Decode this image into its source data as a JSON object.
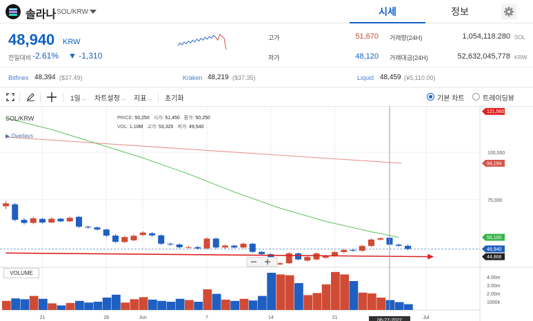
{
  "header": {
    "coin_name": "솔라나",
    "pair": "SOL/KRW",
    "tabs": [
      {
        "label": "시세",
        "active": true
      },
      {
        "label": "정보",
        "active": false
      }
    ]
  },
  "ticker": {
    "price": "48,940",
    "unit": "KRW",
    "change_label": "전일대비",
    "change_pct": "-2.61%",
    "change_abs": "▼ -1,310",
    "high_label": "고가",
    "high_value": "51,670",
    "low_label": "저가",
    "low_value": "48,120",
    "volume_label": "거래량(24H)",
    "volume_value": "1,054,118.280",
    "volume_unit": "SOL",
    "amount_label": "거래대금(24H)",
    "amount_value": "52,632,045,778",
    "amount_unit": "KRW",
    "sparkline": [
      30,
      33,
      31,
      34,
      32,
      35,
      33,
      36,
      34,
      37,
      35,
      38,
      36,
      39,
      37,
      40,
      38,
      41,
      39,
      36,
      42,
      40,
      38,
      26
    ]
  },
  "exchanges": [
    {
      "name": "Bitfinex",
      "price": "48,394",
      "sub": "($37.49)"
    },
    {
      "name": "Kraken",
      "price": "48,219",
      "sub": "($37.35)"
    },
    {
      "name": "Liquid",
      "price": "48,459",
      "sub": "(¥5,110.00)"
    }
  ],
  "toolbar": {
    "interval": "1일",
    "chart_settings": "차트설정",
    "indicators": "지표",
    "reset": "초기화",
    "basic_chart": "기본 차트",
    "tradingview": "트레이딩뷰"
  },
  "chart_labels": {
    "symbol": "SOL/KRW",
    "overlays": "Overlays",
    "volume_box": "VOLUME",
    "ohlc": {
      "price_label": "PRICE:",
      "price": "50,250",
      "open_label": "시가:",
      "open": "51,450",
      "close_label": "종가:",
      "close": "50,250",
      "vol_label": "VOL:",
      "vol": "1.10M",
      "high_label": "고가:",
      "high": "53,320",
      "low_label": "저가:",
      "low": "49,540"
    }
  },
  "chart_data": {
    "type": "candlestick",
    "y_ticks": [
      "100,000",
      "75,000"
    ],
    "y_tick_values": [
      100000,
      75000
    ],
    "vol_ticks": [
      "4.00m",
      "3.00m",
      "2.00m",
      "1000k"
    ],
    "vol_tick_values": [
      4000000,
      3000000,
      2000000,
      1000000
    ],
    "x_ticks": [
      "21",
      "28",
      "Jun",
      "7",
      "14",
      "21",
      "Jul"
    ],
    "x_tick_index": [
      4,
      11,
      15,
      22,
      29,
      36,
      46
    ],
    "ylim": [
      40000,
      124000
    ],
    "vol_max": 5000000,
    "crosshair_index": 42,
    "crosshair_date": "06-27-2022",
    "price_tags": [
      {
        "value": 121560,
        "label": "121,560",
        "color": "#e02020"
      },
      {
        "value": 94194,
        "label": "94,194",
        "color": "#d5574a"
      },
      {
        "value": 55100,
        "label": "55,100",
        "color": "#36b34a"
      },
      {
        "value": 48940,
        "label": "48,940",
        "color": "#1f5fbf"
      },
      {
        "value": 44868,
        "label": "44,868",
        "color": "#222222"
      }
    ],
    "ma_long": {
      "color": "#e58b86",
      "from": [
        0,
        108000
      ],
      "to": [
        43,
        94194
      ]
    },
    "ma_short": {
      "color": "#5dc25d",
      "points": [
        [
          0,
          118000
        ],
        [
          5,
          112000
        ],
        [
          10,
          104500
        ],
        [
          15,
          97000
        ],
        [
          20,
          88500
        ],
        [
          25,
          79000
        ],
        [
          30,
          70500
        ],
        [
          35,
          63500
        ],
        [
          40,
          58000
        ],
        [
          43,
          55100
        ]
      ]
    },
    "trend_line": {
      "color": "#dd2020",
      "from": [
        0,
        46800
      ],
      "to": [
        47,
        44868
      ]
    },
    "current_price": 48940,
    "candles": [
      {
        "o": 71500,
        "c": 73000,
        "h": 74200,
        "l": 70000,
        "v": 1100000
      },
      {
        "o": 72500,
        "c": 64300,
        "h": 73200,
        "l": 63500,
        "v": 1400000
      },
      {
        "o": 64300,
        "c": 62700,
        "h": 65200,
        "l": 61800,
        "v": 1300000
      },
      {
        "o": 62700,
        "c": 65100,
        "h": 66000,
        "l": 62000,
        "v": 1700000
      },
      {
        "o": 64800,
        "c": 62900,
        "h": 65400,
        "l": 62300,
        "v": 1350000
      },
      {
        "o": 62900,
        "c": 64900,
        "h": 65700,
        "l": 62600,
        "v": 800000
      },
      {
        "o": 64900,
        "c": 63500,
        "h": 65300,
        "l": 63100,
        "v": 550000
      },
      {
        "o": 63500,
        "c": 65400,
        "h": 66100,
        "l": 63200,
        "v": 850000
      },
      {
        "o": 65900,
        "c": 60700,
        "h": 66400,
        "l": 60000,
        "v": 1100000
      },
      {
        "o": 60700,
        "c": 60300,
        "h": 61200,
        "l": 59500,
        "v": 900000
      },
      {
        "o": 60300,
        "c": 59200,
        "h": 60900,
        "l": 58700,
        "v": 1000000
      },
      {
        "o": 59200,
        "c": 56000,
        "h": 59600,
        "l": 55300,
        "v": 1500000
      },
      {
        "o": 56000,
        "c": 52700,
        "h": 56800,
        "l": 52100,
        "v": 1850000
      },
      {
        "o": 52600,
        "c": 55200,
        "h": 55900,
        "l": 52000,
        "v": 900000
      },
      {
        "o": 53500,
        "c": 55900,
        "h": 56600,
        "l": 53000,
        "v": 1300000
      },
      {
        "o": 56300,
        "c": 57600,
        "h": 58300,
        "l": 55700,
        "v": 1550000
      },
      {
        "o": 57200,
        "c": 56100,
        "h": 57900,
        "l": 55400,
        "v": 1250000
      },
      {
        "o": 56100,
        "c": 51700,
        "h": 56700,
        "l": 51000,
        "v": 1100000
      },
      {
        "o": 51700,
        "c": 51300,
        "h": 52200,
        "l": 50600,
        "v": 1000000
      },
      {
        "o": 51300,
        "c": 49800,
        "h": 51900,
        "l": 49100,
        "v": 1350000
      },
      {
        "o": 49800,
        "c": 49900,
        "h": 50600,
        "l": 49200,
        "v": 1200000
      },
      {
        "o": 49900,
        "c": 49200,
        "h": 50600,
        "l": 48600,
        "v": 1000000
      },
      {
        "o": 49200,
        "c": 54400,
        "h": 55100,
        "l": 48800,
        "v": 2500000
      },
      {
        "o": 54400,
        "c": 49700,
        "h": 55100,
        "l": 49100,
        "v": 1950000
      },
      {
        "o": 49700,
        "c": 50700,
        "h": 51400,
        "l": 49100,
        "v": 1250000
      },
      {
        "o": 50700,
        "c": 49700,
        "h": 51200,
        "l": 49200,
        "v": 1100000
      },
      {
        "o": 49700,
        "c": 51700,
        "h": 52300,
        "l": 49200,
        "v": 1350000
      },
      {
        "o": 51700,
        "c": 47400,
        "h": 52200,
        "l": 46900,
        "v": 1150000
      },
      {
        "o": 47400,
        "c": 46200,
        "h": 47900,
        "l": 45600,
        "v": 1700000
      },
      {
        "o": 46200,
        "c": 40800,
        "h": 46600,
        "l": 40100,
        "v": 4500000
      },
      {
        "o": 40800,
        "c": 41400,
        "h": 42100,
        "l": 40200,
        "v": 4300000
      },
      {
        "o": 41400,
        "c": 46600,
        "h": 47200,
        "l": 40900,
        "v": 4200000
      },
      {
        "o": 46600,
        "c": 43400,
        "h": 47100,
        "l": 42900,
        "v": 3250000
      },
      {
        "o": 42800,
        "c": 44700,
        "h": 45400,
        "l": 42300,
        "v": 1800000
      },
      {
        "o": 43400,
        "c": 46600,
        "h": 47200,
        "l": 42900,
        "v": 2050000
      },
      {
        "o": 44300,
        "c": 45300,
        "h": 45900,
        "l": 43800,
        "v": 3100000
      },
      {
        "o": 45300,
        "c": 47300,
        "h": 47900,
        "l": 44800,
        "v": 4600000
      },
      {
        "o": 47300,
        "c": 48400,
        "h": 49000,
        "l": 46800,
        "v": 4300000
      },
      {
        "o": 48400,
        "c": 48000,
        "h": 48900,
        "l": 47500,
        "v": 3500000
      },
      {
        "o": 48000,
        "c": 50500,
        "h": 51100,
        "l": 47500,
        "v": 2100000
      },
      {
        "o": 50500,
        "c": 53900,
        "h": 54500,
        "l": 50000,
        "v": 2000000
      },
      {
        "o": 53900,
        "c": 54600,
        "h": 55100,
        "l": 53400,
        "v": 1500000
      },
      {
        "o": 54900,
        "c": 51200,
        "h": 55400,
        "l": 50700,
        "v": 1200000
      },
      {
        "o": 51200,
        "c": 50600,
        "h": 51800,
        "l": 50100,
        "v": 950000
      },
      {
        "o": 50600,
        "c": 48940,
        "h": 51300,
        "l": 48300,
        "v": 700000
      }
    ]
  }
}
